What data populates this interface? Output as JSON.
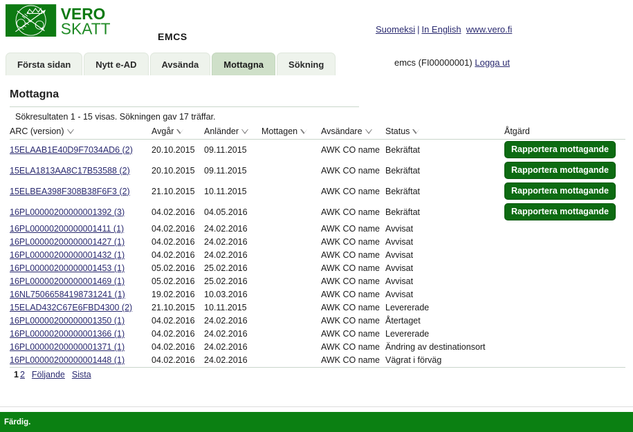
{
  "header": {
    "logo_alt": "Vero Skatt",
    "logo_line1": "VERO",
    "logo_line2": "SKATT",
    "app_title": "EMCS",
    "lang_fi": "Suomeksi",
    "lang_separator": "|",
    "lang_en": "In English",
    "site_link": "www.vero.fi",
    "session_user": "emcs (FI00000001)",
    "logout_label": "Logga ut"
  },
  "tabs": [
    {
      "label": "Första sidan",
      "active": false
    },
    {
      "label": "Nytt e-AD",
      "active": false
    },
    {
      "label": "Avsända",
      "active": false
    },
    {
      "label": "Mottagna",
      "active": true
    },
    {
      "label": "Sökning",
      "active": false
    }
  ],
  "main": {
    "page_title": "Mottagna",
    "result_info": "Sökresultaten 1 - 15 visas. Sökningen gav 17 träffar."
  },
  "table": {
    "columns": [
      {
        "label": "ARC (version)",
        "sortable": true
      },
      {
        "label": "Avgår",
        "sortable": true
      },
      {
        "label": "Anländer",
        "sortable": true
      },
      {
        "label": "Mottagen",
        "sortable": true
      },
      {
        "label": "Avsändare",
        "sortable": true
      },
      {
        "label": "Status",
        "sortable": true
      },
      {
        "label": "Åtgärd",
        "sortable": false
      }
    ],
    "action_label": "Rapportera mottagande",
    "rows": [
      {
        "arc": "15ELAAB1E40D9F7034AD6 (2)",
        "departs": "20.10.2015",
        "arrives": "09.11.2015",
        "received": "",
        "sender": "AWK CO name",
        "status": "Bekräftat",
        "action": "Rapportera mottagande",
        "tall": true
      },
      {
        "arc": "15ELA1813AA8C17B53588 (2)",
        "departs": "20.10.2015",
        "arrives": "09.11.2015",
        "received": "",
        "sender": "AWK CO name",
        "status": "Bekräftat",
        "action": "Rapportera mottagande",
        "tall": true
      },
      {
        "arc": "15ELBEA398F308B38F6F3 (2)",
        "departs": "21.10.2015",
        "arrives": "10.11.2015",
        "received": "",
        "sender": "AWK CO name",
        "status": "Bekräftat",
        "action": "Rapportera mottagande",
        "tall": true
      },
      {
        "arc": "16PL00000200000001392 (3)",
        "departs": "04.02.2016",
        "arrives": "04.05.2016",
        "received": "",
        "sender": "AWK CO name",
        "status": "Bekräftat",
        "action": "Rapportera mottagande",
        "tall": true
      },
      {
        "arc": "16PL00000200000001411 (1)",
        "departs": "04.02.2016",
        "arrives": "24.02.2016",
        "received": "",
        "sender": "AWK CO name",
        "status": "Avvisat",
        "action": "",
        "tall": false
      },
      {
        "arc": "16PL00000200000001427 (1)",
        "departs": "04.02.2016",
        "arrives": "24.02.2016",
        "received": "",
        "sender": "AWK CO name",
        "status": "Avvisat",
        "action": "",
        "tall": false
      },
      {
        "arc": "16PL00000200000001432 (1)",
        "departs": "04.02.2016",
        "arrives": "24.02.2016",
        "received": "",
        "sender": "AWK CO name",
        "status": "Avvisat",
        "action": "",
        "tall": false
      },
      {
        "arc": "16PL00000200000001453 (1)",
        "departs": "05.02.2016",
        "arrives": "25.02.2016",
        "received": "",
        "sender": "AWK CO name",
        "status": "Avvisat",
        "action": "",
        "tall": false
      },
      {
        "arc": "16PL00000200000001469 (1)",
        "departs": "05.02.2016",
        "arrives": "25.02.2016",
        "received": "",
        "sender": "AWK CO name",
        "status": "Avvisat",
        "action": "",
        "tall": false
      },
      {
        "arc": "16NL75066584198731241 (1)",
        "departs": "19.02.2016",
        "arrives": "10.03.2016",
        "received": "",
        "sender": "AWK CO name",
        "status": "Avvisat",
        "action": "",
        "tall": false
      },
      {
        "arc": "15ELAD432C67E6FBD4300 (2)",
        "departs": "21.10.2015",
        "arrives": "10.11.2015",
        "received": "",
        "sender": "AWK CO name",
        "status": "Levererade",
        "action": "",
        "tall": false
      },
      {
        "arc": "16PL00000200000001350 (1)",
        "departs": "04.02.2016",
        "arrives": "24.02.2016",
        "received": "",
        "sender": "AWK CO name",
        "status": "Återtaget",
        "action": "",
        "tall": false
      },
      {
        "arc": "16PL00000200000001366 (1)",
        "departs": "04.02.2016",
        "arrives": "24.02.2016",
        "received": "",
        "sender": "AWK CO name",
        "status": "Levererade",
        "action": "",
        "tall": false
      },
      {
        "arc": "16PL00000200000001371 (1)",
        "departs": "04.02.2016",
        "arrives": "24.02.2016",
        "received": "",
        "sender": "AWK CO name",
        "status": "Ändring av destinationsort",
        "action": "",
        "tall": false
      },
      {
        "arc": "16PL00000200000001448 (1)",
        "departs": "04.02.2016",
        "arrives": "24.02.2016",
        "received": "",
        "sender": "AWK CO name",
        "status": "Vägrat i förväg",
        "action": "",
        "tall": false
      }
    ]
  },
  "pagination": {
    "current_page": "1",
    "page_2": "2",
    "next_label": "Följande",
    "last_label": "Sista"
  },
  "statusbar": {
    "text": "Färdig."
  },
  "colors": {
    "brand_green": "#0d7a12",
    "button_green": "#0d6b12",
    "tab_active": "#cfe0c9",
    "tab_inactive": "#eef3ec",
    "link_blue": "#2a2a70",
    "statusbar_green": "#0b8012"
  }
}
